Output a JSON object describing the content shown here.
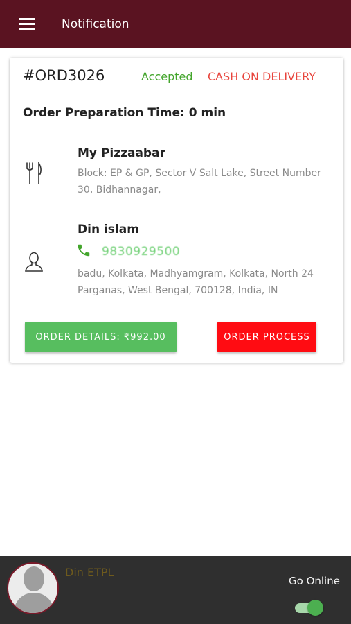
{
  "appbar": {
    "title": "Notification",
    "menu_icon": "hamburger-menu-icon"
  },
  "order": {
    "id": "#ORD3026",
    "status": "Accepted",
    "payment_mode": "CASH ON DELIVERY",
    "preparation_time": "Order Preparation Time: 0 min",
    "restaurant": {
      "icon": "fork-knife-icon",
      "name": "My Pizzaabar",
      "address": "Block: EP & GP, Sector V Salt Lake, Street Number 30, Bidhannagar,"
    },
    "customer": {
      "icon": "user-outline-icon",
      "name": "Din islam",
      "phone_icon": "phone-icon",
      "phone": "9830929500",
      "address": "badu, Kolkata, Madhyamgram, Kolkata, North 24 Parganas, West Bengal, 700128, India, IN"
    },
    "details_button": "ORDER DETAILS: ₹992.00",
    "process_button": "ORDER PROCESS"
  },
  "bottom_bar": {
    "avatar_icon": "avatar-placeholder-icon",
    "user_name": "Din ETPL",
    "go_online_label": "Go Online",
    "online_toggle_on": true
  },
  "colors": {
    "appbar": "#5a1321",
    "accepted": "#43a52c",
    "payment": "#e8453d",
    "details_button": "#57be5f",
    "process_button": "#ff0c12",
    "bottom_bar": "#2f2f2f",
    "toggle": "#4caf50"
  }
}
